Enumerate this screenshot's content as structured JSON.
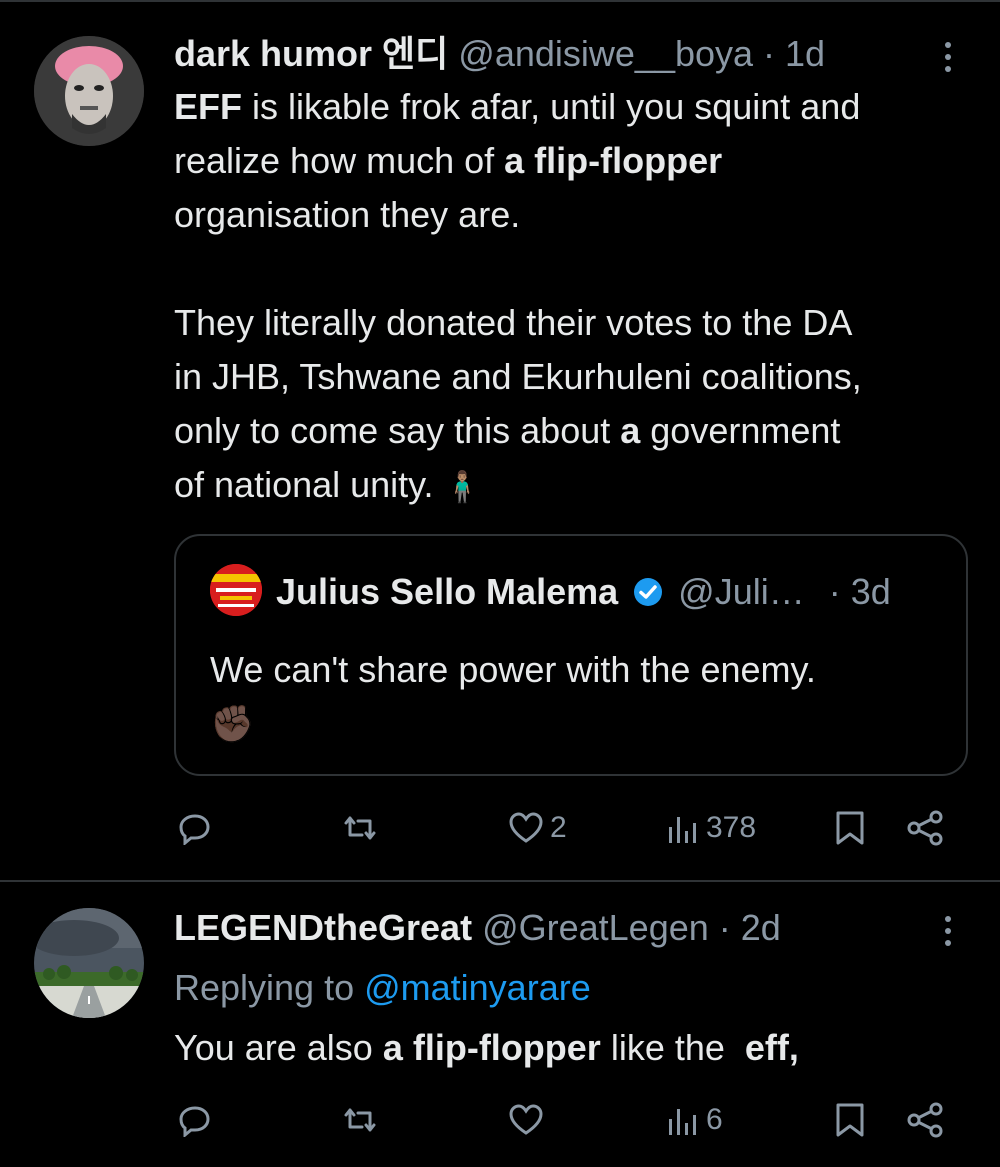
{
  "tweets": [
    {
      "name": "dark humor 엔디",
      "handle": "@andisiwe__boya",
      "time": "· 1d",
      "avatar_icon": "portrait-avatar",
      "body": {
        "l1_b": "EFF",
        "l1": " is likable frok afar, until you squint and",
        "l2": "realize how much of ",
        "l2_b": "a flip-flopper",
        "l3": "organisation they are.",
        "l4": "They literally donated their votes to the DA",
        "l5": "in JHB, Tshwane and Ekurhuleni coalitions,",
        "l6": "only to come say this about ",
        "l6_b": "a",
        "l6_end": " government",
        "l7": "of national unity. ",
        "l7_emoji": "🧍🏽‍♂️"
      },
      "quote": {
        "name": "Julius Sello Malema",
        "verified_icon": "verified-badge-icon",
        "handle": "@Juli…",
        "time": "· 3d",
        "text": "We can't share power with the enemy.",
        "emoji": "✊🏿"
      },
      "stats": {
        "likes": "2",
        "views": "378"
      }
    },
    {
      "name": "LEGENDtheGreat",
      "handle": "@GreatLegen",
      "time": "· 2d",
      "avatar_icon": "storm-landscape-avatar",
      "replying_prefix": "Replying to ",
      "replying_to": "@matinyarare",
      "body": {
        "l1": "You are also ",
        "l1_b": "a flip-flopper",
        "l1_mid": " like the  ",
        "l1_b2": "eff,"
      },
      "stats": {
        "views": "6"
      }
    }
  ],
  "colors": {
    "background": "#000000",
    "text": "#e7e9ea",
    "secondary": "#8b98a5",
    "accent": "#1d9bf0",
    "border": "#2f3336"
  }
}
